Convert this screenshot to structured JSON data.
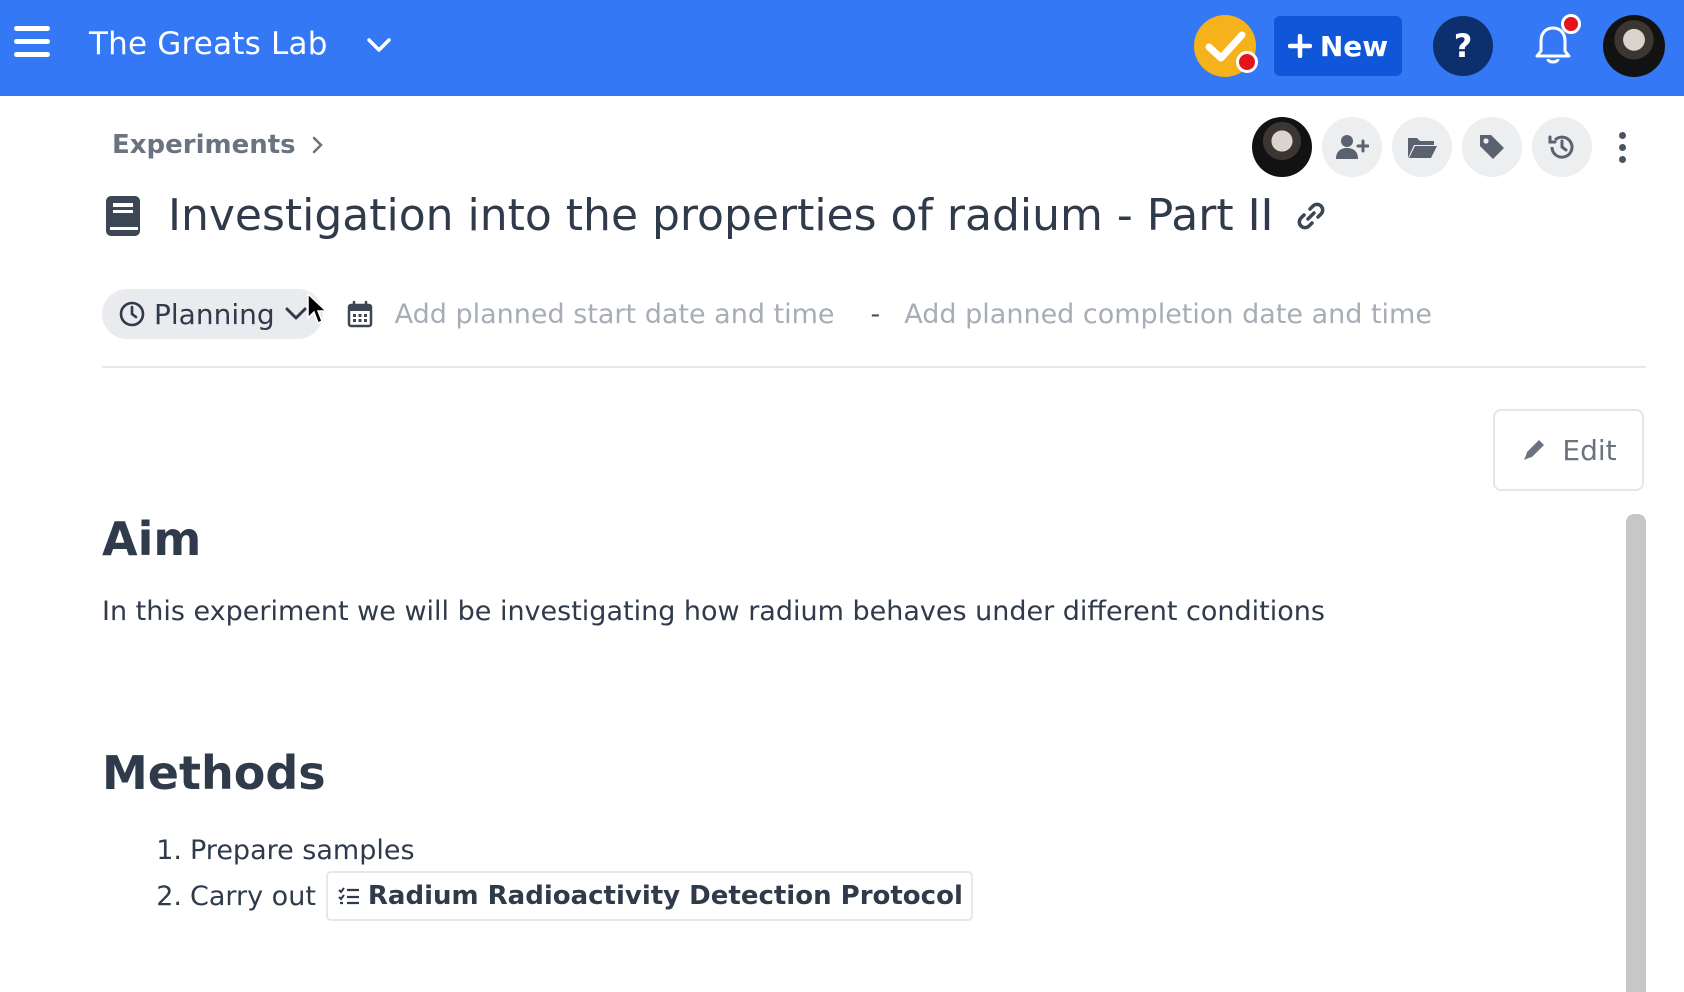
{
  "header": {
    "lab_name": "The Greats Lab",
    "new_button_label": "New",
    "help_label": "?"
  },
  "breadcrumb": {
    "items": [
      "Experiments"
    ]
  },
  "experiment": {
    "title": "Investigation into the properties of radium - Part II",
    "status": "Planning",
    "start_date_placeholder": "Add planned start date and time",
    "date_separator": "-",
    "end_date_placeholder": "Add planned completion date and time"
  },
  "content": {
    "edit_label": "Edit",
    "aim_heading": "Aim",
    "aim_text": "In this experiment we will be investigating how radium behaves under different conditions",
    "methods_heading": "Methods",
    "methods": [
      {
        "number": "1.",
        "text": "Prepare samples"
      },
      {
        "number": "2.",
        "text": "Carry out",
        "protocol_link": "Radium Radioactivity Detection Protocol"
      }
    ]
  },
  "colors": {
    "topbar": "#3478f6",
    "new_button": "#0f56d9",
    "help_button": "#0d2f6e",
    "status_badge": "#f5b21a",
    "notification_dot": "#e3141b"
  },
  "icons": [
    "menu-icon",
    "chevron-down-icon",
    "checkmark-icon",
    "plus-icon",
    "bell-icon",
    "chevron-right-icon",
    "add-user-icon",
    "folder-icon",
    "tag-icon",
    "history-icon",
    "kebab-icon",
    "notebook-icon",
    "link-icon",
    "clock-icon",
    "calendar-icon",
    "pencil-icon",
    "checklist-icon"
  ]
}
